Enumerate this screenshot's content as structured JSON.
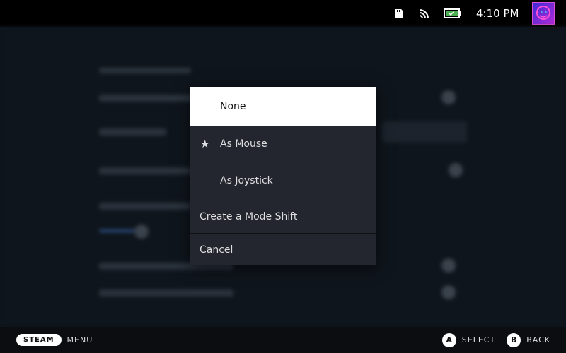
{
  "status_bar": {
    "time": "4:10 PM",
    "icons": [
      "sd-card-icon",
      "wifi-icon",
      "battery-icon",
      "avatar"
    ],
    "battery_color": "#4caf50",
    "avatar_color": "#7a2bd6"
  },
  "menu": {
    "items": [
      {
        "label": "None",
        "selected": true,
        "starred": false
      },
      {
        "label": "As Mouse",
        "selected": false,
        "starred": true
      },
      {
        "label": "As Joystick",
        "selected": false,
        "starred": false
      },
      {
        "label": "Create a Mode Shift",
        "selected": false,
        "starred": false
      }
    ],
    "cancel": "Cancel"
  },
  "footer": {
    "steam": "STEAM",
    "menu": "MENU",
    "a": "A",
    "select": "SELECT",
    "b": "B",
    "back": "BACK"
  }
}
